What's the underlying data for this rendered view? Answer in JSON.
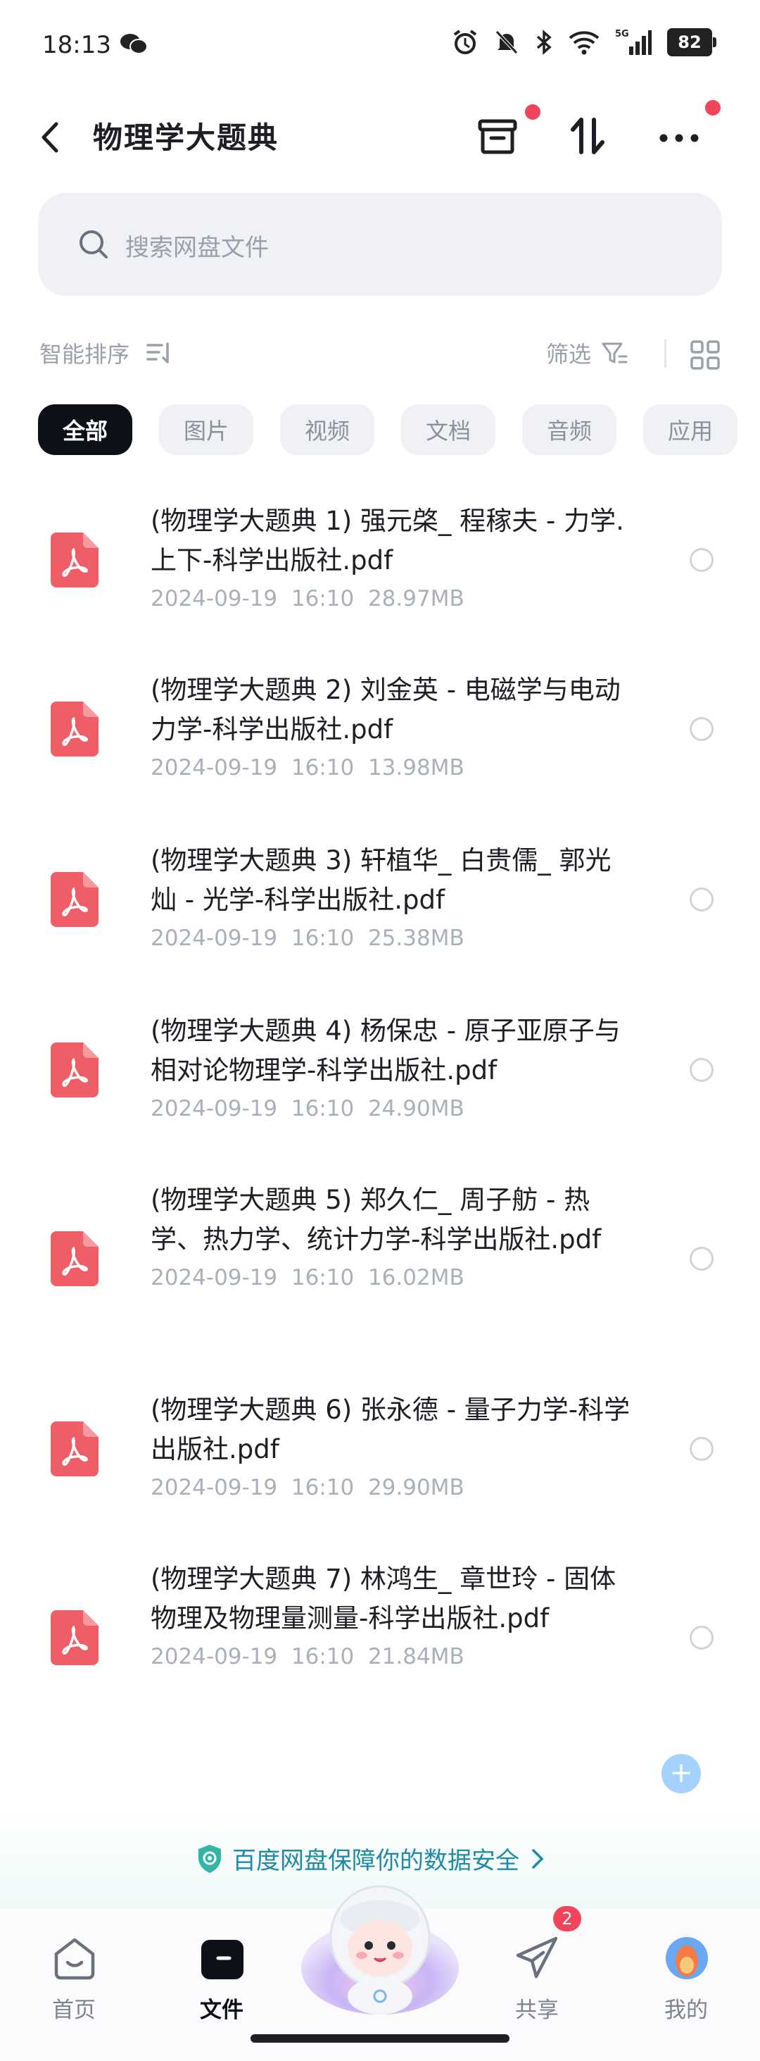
{
  "status": {
    "time": "18:13",
    "battery": "82",
    "network": "5G"
  },
  "header": {
    "title": "物理学大题典"
  },
  "search": {
    "placeholder": "搜索网盘文件"
  },
  "toolbar": {
    "sort_label": "智能排序",
    "filter_label": "筛选"
  },
  "tabs": [
    {
      "label": "全部",
      "active": true
    },
    {
      "label": "图片"
    },
    {
      "label": "视频"
    },
    {
      "label": "文档"
    },
    {
      "label": "音频"
    },
    {
      "label": "应用"
    }
  ],
  "files": [
    {
      "name": "(物理学大题典 1) 强元棨_ 程稼夫 - 力学. 上下-科学出版社.pdf",
      "date": "2024-09-19",
      "time": "16:10",
      "size": "28.97MB"
    },
    {
      "name": "(物理学大题典 2) 刘金英 - 电磁学与电动力学-科学出版社.pdf",
      "date": "2024-09-19",
      "time": "16:10",
      "size": "13.98MB"
    },
    {
      "name": "(物理学大题典 3) 轩植华_ 白贵儒_ 郭光灿 - 光学-科学出版社.pdf",
      "date": "2024-09-19",
      "time": "16:10",
      "size": "25.38MB"
    },
    {
      "name": "(物理学大题典 4) 杨保忠 - 原子亚原子与相对论物理学-科学出版社.pdf",
      "date": "2024-09-19",
      "time": "16:10",
      "size": "24.90MB"
    },
    {
      "name": "(物理学大题典 5) 郑久仁_ 周子舫 - 热学、热力学、统计力学-科学出版社.pdf",
      "date": "2024-09-19",
      "time": "16:10",
      "size": "16.02MB"
    },
    {
      "name": "(物理学大题典 6) 张永德 - 量子力学-科学出版社.pdf",
      "date": "2024-09-19",
      "time": "16:10",
      "size": "29.90MB"
    },
    {
      "name": "(物理学大题典 7) 林鸿生_ 章世玲 - 固体物理及物理量测量-科学出版社.pdf",
      "date": "2024-09-19",
      "time": "16:10",
      "size": "21.84MB"
    }
  ],
  "safety_banner": {
    "text": "百度网盘保障你的数据安全"
  },
  "bottom_nav": [
    {
      "label": "首页"
    },
    {
      "label": "文件",
      "active": true
    },
    {
      "label": "共享",
      "badge": "2"
    },
    {
      "label": "我的"
    }
  ],
  "colors": {
    "accent": "#0d1117",
    "badge": "#f2445a",
    "pdf": "#ef5d66",
    "safety": "#1f8aa8"
  }
}
